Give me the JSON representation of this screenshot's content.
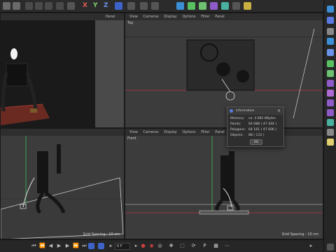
{
  "panel_labels": {
    "perspective": "Panel"
  },
  "viewports": {
    "top": {
      "label": "Top",
      "grid": ""
    },
    "right": {
      "label": "Right",
      "grid": "Grid Spacing : 10 cm"
    },
    "front": {
      "label": "Front",
      "grid": "Grid Spacing : 10 cm"
    }
  },
  "vp_menu": [
    "View",
    "Cameras",
    "Display",
    "Options",
    "Filter",
    "Panel"
  ],
  "toolbar": {
    "axis_x": "X",
    "axis_y": "Y",
    "axis_z": "Z"
  },
  "dialog": {
    "title": "Information",
    "rows": [
      {
        "key": "Memory:",
        "value": "ca. 4 681 KBytes"
      },
      {
        "key": "Points:",
        "value": "64 088 ( 47 444 )"
      },
      {
        "key": "Polygons:",
        "value": "64 161 ( 47 606 )"
      },
      {
        "key": "Objects:",
        "value": "88 ( 112 )"
      }
    ],
    "ok": "OK"
  },
  "timeline": {
    "current_frame": "0 F"
  },
  "colors": {
    "axis_red": "#b8324a",
    "axis_green": "#3fb85a",
    "axis_blue": "#4a7dd6",
    "accent": "#5a7ae0"
  }
}
